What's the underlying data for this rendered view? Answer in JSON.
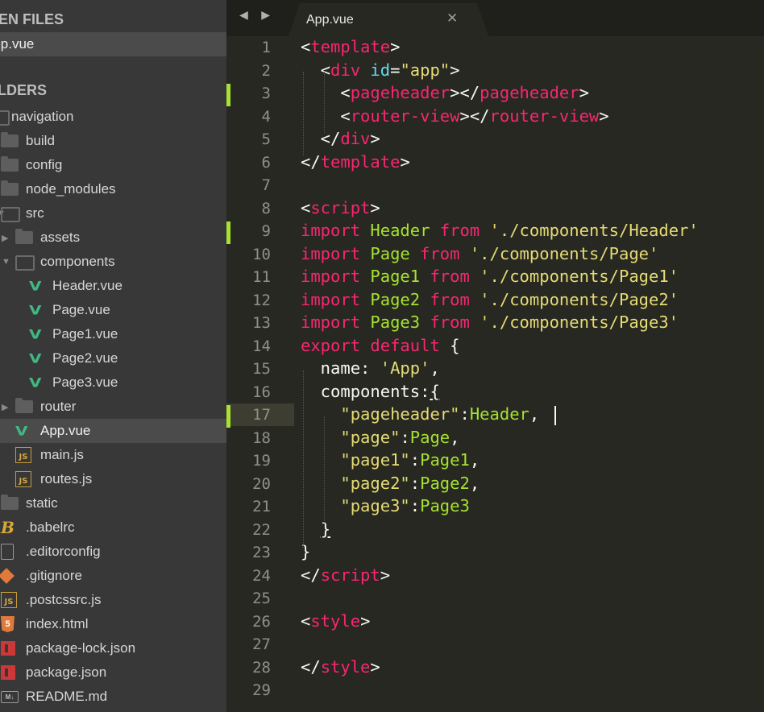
{
  "sidebar": {
    "open_files_header": "OPEN FILES",
    "open_file": "App.vue",
    "folders_header": "FOLDERS",
    "tree": [
      {
        "label": "navigation",
        "icon": "folder-open-icon",
        "depth": 0
      },
      {
        "label": "build",
        "icon": "folder-icon",
        "depth": 1
      },
      {
        "label": "config",
        "icon": "folder-icon",
        "depth": 1
      },
      {
        "label": "node_modules",
        "icon": "folder-icon",
        "depth": 1
      },
      {
        "label": "src",
        "icon": "folder-open-icon",
        "depth": 1
      },
      {
        "label": "assets",
        "icon": "folder-icon",
        "depth": 2
      },
      {
        "label": "components",
        "icon": "folder-open-icon",
        "depth": 2
      },
      {
        "label": "Header.vue",
        "icon": "vue-icon",
        "depth": 3
      },
      {
        "label": "Page.vue",
        "icon": "vue-icon",
        "depth": 3
      },
      {
        "label": "Page1.vue",
        "icon": "vue-icon",
        "depth": 3
      },
      {
        "label": "Page2.vue",
        "icon": "vue-icon",
        "depth": 3
      },
      {
        "label": "Page3.vue",
        "icon": "vue-icon",
        "depth": 3
      },
      {
        "label": "router",
        "icon": "folder-icon",
        "depth": 2
      },
      {
        "label": "App.vue",
        "icon": "vue-icon",
        "depth": 2,
        "selected": true
      },
      {
        "label": "main.js",
        "icon": "js-icon",
        "depth": 2
      },
      {
        "label": "routes.js",
        "icon": "js-icon",
        "depth": 2
      },
      {
        "label": "static",
        "icon": "folder-icon",
        "depth": 1
      },
      {
        "label": ".babelrc",
        "icon": "babel-icon",
        "depth": 1
      },
      {
        "label": ".editorconfig",
        "icon": "file-icon",
        "depth": 1
      },
      {
        "label": ".gitignore",
        "icon": "git-icon",
        "depth": 1
      },
      {
        "label": ".postcssrc.js",
        "icon": "js-icon",
        "depth": 1
      },
      {
        "label": "index.html",
        "icon": "html-icon",
        "depth": 1
      },
      {
        "label": "package-lock.json",
        "icon": "npm-icon",
        "depth": 1
      },
      {
        "label": "package.json",
        "icon": "npm-icon",
        "depth": 1
      },
      {
        "label": "README.md",
        "icon": "markdown-icon",
        "depth": 1
      }
    ]
  },
  "tabbar": {
    "nav_arrows": "◀ ▶",
    "active_tab": "App.vue",
    "close_glyph": "✕"
  },
  "editor": {
    "current_line": 17,
    "modified_lines": [
      3,
      9,
      17
    ],
    "colors": {
      "background": "#272822",
      "tag": "#f92672",
      "keyword": "#f92672",
      "attribute": "#66d9ef",
      "string": "#e6db74",
      "identifier": "#a6e22e",
      "text": "#f8f8f2",
      "line_number": "#8f908a"
    },
    "lines": [
      {
        "n": "1",
        "tokens": [
          [
            "<",
            "t"
          ],
          [
            "template",
            "r"
          ],
          [
            ">",
            "t"
          ]
        ]
      },
      {
        "n": "2",
        "tokens": [
          [
            "  <",
            "t"
          ],
          [
            "div",
            "r"
          ],
          [
            " ",
            "t"
          ],
          [
            "id",
            "b"
          ],
          [
            "=",
            "t"
          ],
          [
            "\"app\"",
            "y"
          ],
          [
            ">",
            "t"
          ]
        ]
      },
      {
        "n": "3",
        "tokens": [
          [
            "    <",
            "t"
          ],
          [
            "pageheader",
            "r"
          ],
          [
            "></",
            "t"
          ],
          [
            "pageheader",
            "r"
          ],
          [
            ">",
            "t"
          ]
        ]
      },
      {
        "n": "4",
        "tokens": [
          [
            "    <",
            "t"
          ],
          [
            "router-view",
            "r"
          ],
          [
            "></",
            "t"
          ],
          [
            "router-view",
            "r"
          ],
          [
            ">",
            "t"
          ]
        ]
      },
      {
        "n": "5",
        "tokens": [
          [
            "  </",
            "t"
          ],
          [
            "div",
            "r"
          ],
          [
            ">",
            "t"
          ]
        ]
      },
      {
        "n": "6",
        "tokens": [
          [
            "</",
            "t"
          ],
          [
            "template",
            "r"
          ],
          [
            ">",
            "t"
          ]
        ]
      },
      {
        "n": "7",
        "tokens": []
      },
      {
        "n": "8",
        "tokens": [
          [
            "<",
            "t"
          ],
          [
            "script",
            "r"
          ],
          [
            ">",
            "t"
          ]
        ]
      },
      {
        "n": "9",
        "tokens": [
          [
            "import",
            "r"
          ],
          [
            " ",
            "t"
          ],
          [
            "Header",
            "g"
          ],
          [
            " ",
            "t"
          ],
          [
            "from",
            "r"
          ],
          [
            " ",
            "t"
          ],
          [
            "'./components/Header'",
            "y"
          ]
        ]
      },
      {
        "n": "10",
        "tokens": [
          [
            "import",
            "r"
          ],
          [
            " ",
            "t"
          ],
          [
            "Page",
            "g"
          ],
          [
            " ",
            "t"
          ],
          [
            "from",
            "r"
          ],
          [
            " ",
            "t"
          ],
          [
            "'./components/Page'",
            "y"
          ]
        ]
      },
      {
        "n": "11",
        "tokens": [
          [
            "import",
            "r"
          ],
          [
            " ",
            "t"
          ],
          [
            "Page1",
            "g"
          ],
          [
            " ",
            "t"
          ],
          [
            "from",
            "r"
          ],
          [
            " ",
            "t"
          ],
          [
            "'./components/Page1'",
            "y"
          ]
        ]
      },
      {
        "n": "12",
        "tokens": [
          [
            "import",
            "r"
          ],
          [
            " ",
            "t"
          ],
          [
            "Page2",
            "g"
          ],
          [
            " ",
            "t"
          ],
          [
            "from",
            "r"
          ],
          [
            " ",
            "t"
          ],
          [
            "'./components/Page2'",
            "y"
          ]
        ]
      },
      {
        "n": "13",
        "tokens": [
          [
            "import",
            "r"
          ],
          [
            " ",
            "t"
          ],
          [
            "Page3",
            "g"
          ],
          [
            " ",
            "t"
          ],
          [
            "from",
            "r"
          ],
          [
            " ",
            "t"
          ],
          [
            "'./components/Page3'",
            "y"
          ]
        ]
      },
      {
        "n": "14",
        "tokens": [
          [
            "export",
            "r"
          ],
          [
            " ",
            "t"
          ],
          [
            "default",
            "r"
          ],
          [
            " {",
            "t"
          ]
        ]
      },
      {
        "n": "15",
        "tokens": [
          [
            "  name: ",
            "t"
          ],
          [
            "'App'",
            "y"
          ],
          [
            ",",
            "t"
          ]
        ]
      },
      {
        "n": "16",
        "tokens": [
          [
            "  components:",
            "t"
          ],
          [
            "{",
            "u"
          ]
        ]
      },
      {
        "n": "17",
        "tokens": [
          [
            "    ",
            "t"
          ],
          [
            "\"pageheader\"",
            "y"
          ],
          [
            ":",
            "t"
          ],
          [
            "Header",
            "g"
          ],
          [
            ",",
            "t"
          ]
        ]
      },
      {
        "n": "18",
        "tokens": [
          [
            "    ",
            "t"
          ],
          [
            "\"page\"",
            "y"
          ],
          [
            ":",
            "t"
          ],
          [
            "Page",
            "g"
          ],
          [
            ",",
            "t"
          ]
        ]
      },
      {
        "n": "19",
        "tokens": [
          [
            "    ",
            "t"
          ],
          [
            "\"page1\"",
            "y"
          ],
          [
            ":",
            "t"
          ],
          [
            "Page1",
            "g"
          ],
          [
            ",",
            "t"
          ]
        ]
      },
      {
        "n": "20",
        "tokens": [
          [
            "    ",
            "t"
          ],
          [
            "\"page2\"",
            "y"
          ],
          [
            ":",
            "t"
          ],
          [
            "Page2",
            "g"
          ],
          [
            ",",
            "t"
          ]
        ]
      },
      {
        "n": "21",
        "tokens": [
          [
            "    ",
            "t"
          ],
          [
            "\"page3\"",
            "y"
          ],
          [
            ":",
            "t"
          ],
          [
            "Page3",
            "g"
          ]
        ]
      },
      {
        "n": "22",
        "tokens": [
          [
            "  ",
            "t"
          ],
          [
            "}",
            "u"
          ]
        ]
      },
      {
        "n": "23",
        "tokens": [
          [
            "}",
            "t"
          ]
        ]
      },
      {
        "n": "24",
        "tokens": [
          [
            "</",
            "t"
          ],
          [
            "script",
            "r"
          ],
          [
            ">",
            "t"
          ]
        ]
      },
      {
        "n": "25",
        "tokens": []
      },
      {
        "n": "26",
        "tokens": [
          [
            "<",
            "t"
          ],
          [
            "style",
            "r"
          ],
          [
            ">",
            "t"
          ]
        ]
      },
      {
        "n": "27",
        "tokens": []
      },
      {
        "n": "28",
        "tokens": [
          [
            "</",
            "t"
          ],
          [
            "style",
            "r"
          ],
          [
            ">",
            "t"
          ]
        ]
      },
      {
        "n": "29",
        "tokens": []
      }
    ]
  }
}
